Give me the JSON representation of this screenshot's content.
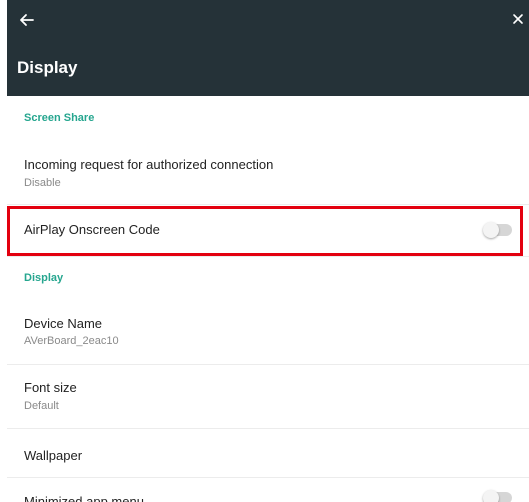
{
  "header": {
    "title": "Display",
    "back_icon": "arrow-left-icon",
    "close_icon": "close-x-icon"
  },
  "sections": {
    "screen_share": {
      "header": "Screen Share",
      "incoming": {
        "title": "Incoming request for authorized connection",
        "value": "Disable"
      },
      "airplay": {
        "title": "AirPlay Onscreen Code",
        "toggle_on": false
      }
    },
    "display": {
      "header": "Display",
      "device_name": {
        "title": "Device Name",
        "value": "AVerBoard_2eac10"
      },
      "font_size": {
        "title": "Font size",
        "value": "Default"
      },
      "wallpaper": {
        "title": "Wallpaper"
      },
      "minimized_menu": {
        "title": "Minimized app menu",
        "toggle_on": false
      }
    }
  },
  "colors": {
    "appbar": "#253238",
    "accent": "#26a68f",
    "highlight": "#e3000f"
  }
}
